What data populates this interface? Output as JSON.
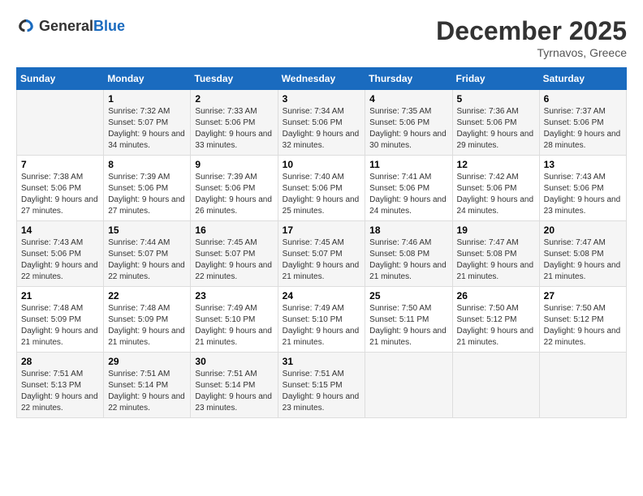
{
  "logo": {
    "text_general": "General",
    "text_blue": "Blue"
  },
  "title": "December 2025",
  "location": "Tyrnavos, Greece",
  "headers": [
    "Sunday",
    "Monday",
    "Tuesday",
    "Wednesday",
    "Thursday",
    "Friday",
    "Saturday"
  ],
  "weeks": [
    [
      {
        "day": "",
        "sunrise": "",
        "sunset": "",
        "daylight": ""
      },
      {
        "day": "1",
        "sunrise": "Sunrise: 7:32 AM",
        "sunset": "Sunset: 5:07 PM",
        "daylight": "Daylight: 9 hours and 34 minutes."
      },
      {
        "day": "2",
        "sunrise": "Sunrise: 7:33 AM",
        "sunset": "Sunset: 5:06 PM",
        "daylight": "Daylight: 9 hours and 33 minutes."
      },
      {
        "day": "3",
        "sunrise": "Sunrise: 7:34 AM",
        "sunset": "Sunset: 5:06 PM",
        "daylight": "Daylight: 9 hours and 32 minutes."
      },
      {
        "day": "4",
        "sunrise": "Sunrise: 7:35 AM",
        "sunset": "Sunset: 5:06 PM",
        "daylight": "Daylight: 9 hours and 30 minutes."
      },
      {
        "day": "5",
        "sunrise": "Sunrise: 7:36 AM",
        "sunset": "Sunset: 5:06 PM",
        "daylight": "Daylight: 9 hours and 29 minutes."
      },
      {
        "day": "6",
        "sunrise": "Sunrise: 7:37 AM",
        "sunset": "Sunset: 5:06 PM",
        "daylight": "Daylight: 9 hours and 28 minutes."
      }
    ],
    [
      {
        "day": "7",
        "sunrise": "Sunrise: 7:38 AM",
        "sunset": "Sunset: 5:06 PM",
        "daylight": "Daylight: 9 hours and 27 minutes."
      },
      {
        "day": "8",
        "sunrise": "Sunrise: 7:39 AM",
        "sunset": "Sunset: 5:06 PM",
        "daylight": "Daylight: 9 hours and 27 minutes."
      },
      {
        "day": "9",
        "sunrise": "Sunrise: 7:39 AM",
        "sunset": "Sunset: 5:06 PM",
        "daylight": "Daylight: 9 hours and 26 minutes."
      },
      {
        "day": "10",
        "sunrise": "Sunrise: 7:40 AM",
        "sunset": "Sunset: 5:06 PM",
        "daylight": "Daylight: 9 hours and 25 minutes."
      },
      {
        "day": "11",
        "sunrise": "Sunrise: 7:41 AM",
        "sunset": "Sunset: 5:06 PM",
        "daylight": "Daylight: 9 hours and 24 minutes."
      },
      {
        "day": "12",
        "sunrise": "Sunrise: 7:42 AM",
        "sunset": "Sunset: 5:06 PM",
        "daylight": "Daylight: 9 hours and 24 minutes."
      },
      {
        "day": "13",
        "sunrise": "Sunrise: 7:43 AM",
        "sunset": "Sunset: 5:06 PM",
        "daylight": "Daylight: 9 hours and 23 minutes."
      }
    ],
    [
      {
        "day": "14",
        "sunrise": "Sunrise: 7:43 AM",
        "sunset": "Sunset: 5:06 PM",
        "daylight": "Daylight: 9 hours and 22 minutes."
      },
      {
        "day": "15",
        "sunrise": "Sunrise: 7:44 AM",
        "sunset": "Sunset: 5:07 PM",
        "daylight": "Daylight: 9 hours and 22 minutes."
      },
      {
        "day": "16",
        "sunrise": "Sunrise: 7:45 AM",
        "sunset": "Sunset: 5:07 PM",
        "daylight": "Daylight: 9 hours and 22 minutes."
      },
      {
        "day": "17",
        "sunrise": "Sunrise: 7:45 AM",
        "sunset": "Sunset: 5:07 PM",
        "daylight": "Daylight: 9 hours and 21 minutes."
      },
      {
        "day": "18",
        "sunrise": "Sunrise: 7:46 AM",
        "sunset": "Sunset: 5:08 PM",
        "daylight": "Daylight: 9 hours and 21 minutes."
      },
      {
        "day": "19",
        "sunrise": "Sunrise: 7:47 AM",
        "sunset": "Sunset: 5:08 PM",
        "daylight": "Daylight: 9 hours and 21 minutes."
      },
      {
        "day": "20",
        "sunrise": "Sunrise: 7:47 AM",
        "sunset": "Sunset: 5:08 PM",
        "daylight": "Daylight: 9 hours and 21 minutes."
      }
    ],
    [
      {
        "day": "21",
        "sunrise": "Sunrise: 7:48 AM",
        "sunset": "Sunset: 5:09 PM",
        "daylight": "Daylight: 9 hours and 21 minutes."
      },
      {
        "day": "22",
        "sunrise": "Sunrise: 7:48 AM",
        "sunset": "Sunset: 5:09 PM",
        "daylight": "Daylight: 9 hours and 21 minutes."
      },
      {
        "day": "23",
        "sunrise": "Sunrise: 7:49 AM",
        "sunset": "Sunset: 5:10 PM",
        "daylight": "Daylight: 9 hours and 21 minutes."
      },
      {
        "day": "24",
        "sunrise": "Sunrise: 7:49 AM",
        "sunset": "Sunset: 5:10 PM",
        "daylight": "Daylight: 9 hours and 21 minutes."
      },
      {
        "day": "25",
        "sunrise": "Sunrise: 7:50 AM",
        "sunset": "Sunset: 5:11 PM",
        "daylight": "Daylight: 9 hours and 21 minutes."
      },
      {
        "day": "26",
        "sunrise": "Sunrise: 7:50 AM",
        "sunset": "Sunset: 5:12 PM",
        "daylight": "Daylight: 9 hours and 21 minutes."
      },
      {
        "day": "27",
        "sunrise": "Sunrise: 7:50 AM",
        "sunset": "Sunset: 5:12 PM",
        "daylight": "Daylight: 9 hours and 22 minutes."
      }
    ],
    [
      {
        "day": "28",
        "sunrise": "Sunrise: 7:51 AM",
        "sunset": "Sunset: 5:13 PM",
        "daylight": "Daylight: 9 hours and 22 minutes."
      },
      {
        "day": "29",
        "sunrise": "Sunrise: 7:51 AM",
        "sunset": "Sunset: 5:14 PM",
        "daylight": "Daylight: 9 hours and 22 minutes."
      },
      {
        "day": "30",
        "sunrise": "Sunrise: 7:51 AM",
        "sunset": "Sunset: 5:14 PM",
        "daylight": "Daylight: 9 hours and 23 minutes."
      },
      {
        "day": "31",
        "sunrise": "Sunrise: 7:51 AM",
        "sunset": "Sunset: 5:15 PM",
        "daylight": "Daylight: 9 hours and 23 minutes."
      },
      {
        "day": "",
        "sunrise": "",
        "sunset": "",
        "daylight": ""
      },
      {
        "day": "",
        "sunrise": "",
        "sunset": "",
        "daylight": ""
      },
      {
        "day": "",
        "sunrise": "",
        "sunset": "",
        "daylight": ""
      }
    ]
  ]
}
